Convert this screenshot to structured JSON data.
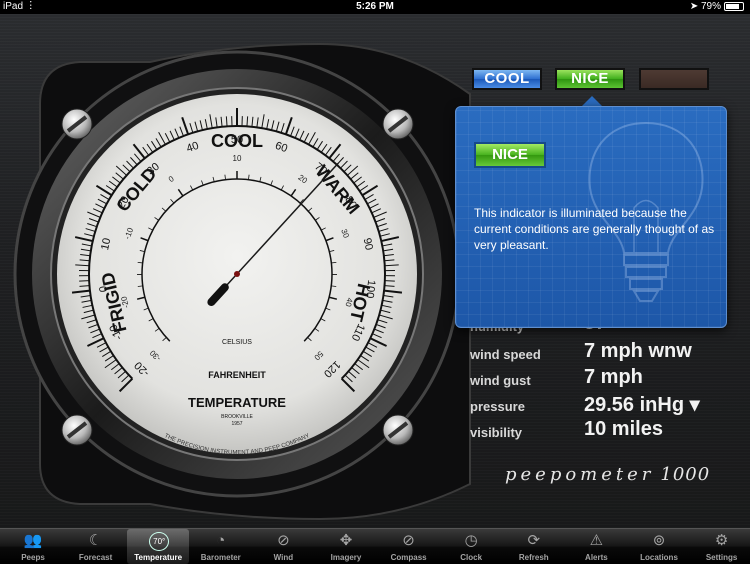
{
  "status_bar": {
    "device": "iPad",
    "time": "5:26 PM",
    "battery": "79%",
    "battery_level": 0.79
  },
  "gauge": {
    "top_label": "COOL",
    "left_label": "COLD",
    "right_label": "WARM",
    "lower_left_label": "FRIGID",
    "lower_right_label": "HOT",
    "bottom_label": "TEMPERATURE",
    "scale_label_inner": "CELSIUS",
    "scale_label_outer": "FAHRENHEIT",
    "maker_line1": "BROOKVILLE",
    "maker_line2": "1957",
    "maker_line3": "THE PRECISION INSTRUMENT AND PEEP COMPANY",
    "fahrenheit_ticks": [
      "-20",
      "-10",
      "0",
      "10",
      "20",
      "30",
      "40",
      "50",
      "60",
      "70",
      "80",
      "90",
      "100",
      "110",
      "120"
    ],
    "celsius_ticks": [
      "-30",
      "-20",
      "-10",
      "0",
      "10",
      "20",
      "30",
      "40",
      "50"
    ],
    "needle_value_f": 72
  },
  "indicators": {
    "cool": "COOL",
    "nice": "NICE",
    "hot": ""
  },
  "popover": {
    "badge": "NICE",
    "text": "This indicator is illuminated because the current conditions are generally thought of as very pleasant."
  },
  "readings": [
    {
      "label": "humidity",
      "value": "37"
    },
    {
      "label": "wind speed",
      "value": "7 mph wnw"
    },
    {
      "label": "wind gust",
      "value": "7 mph"
    },
    {
      "label": "pressure",
      "value": "29.56 inHg ▾"
    },
    {
      "label": "visibility",
      "value": "10 miles"
    }
  ],
  "brand": {
    "name": "peepometer",
    "model": "1000"
  },
  "tabs": [
    {
      "label": "Peeps",
      "icon": "people-icon"
    },
    {
      "label": "Forecast",
      "icon": "moon-icon"
    },
    {
      "label": "Temperature",
      "icon": "thermometer-dial-icon",
      "active": true,
      "badge": "70°"
    },
    {
      "label": "Barometer",
      "icon": "gauge-icon"
    },
    {
      "label": "Wind",
      "icon": "compass-needle-icon"
    },
    {
      "label": "Imagery",
      "icon": "satellite-icon"
    },
    {
      "label": "Compass",
      "icon": "compass-icon"
    },
    {
      "label": "Clock",
      "icon": "clock-icon"
    },
    {
      "label": "Refresh",
      "icon": "refresh-icon"
    },
    {
      "label": "Alerts",
      "icon": "warning-icon"
    },
    {
      "label": "Locations",
      "icon": "location-icon"
    },
    {
      "label": "Settings",
      "icon": "gear-icon"
    }
  ],
  "colors": {
    "accent_blue": "#2d6fd0",
    "accent_green": "#3fae1c",
    "popover_blue": "#1d57a8"
  }
}
